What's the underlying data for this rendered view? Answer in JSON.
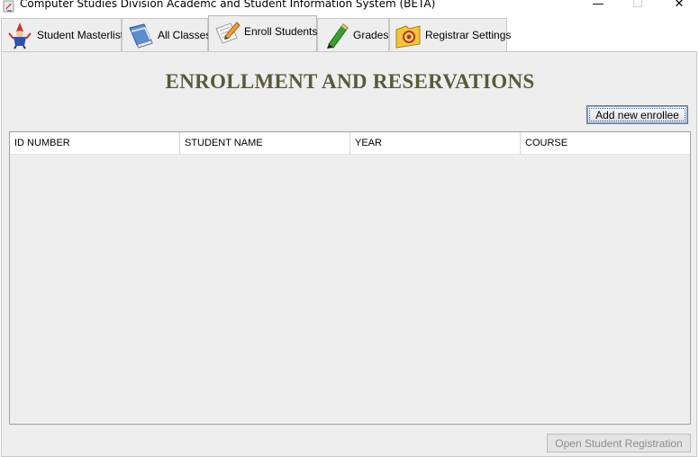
{
  "window": {
    "title": "Computer Studies Division Academc and Student Information System (BETA)",
    "minimize_glyph": "—",
    "maximize_glyph": "☐",
    "close_glyph": "✕"
  },
  "tabs": [
    {
      "label": "Student Masterlist",
      "icon": "wizard-icon",
      "active": false
    },
    {
      "label": "All Classes",
      "icon": "books-icon",
      "active": false
    },
    {
      "label": "Enroll Students",
      "icon": "pencil-paper-icon",
      "active": true
    },
    {
      "label": "Grades",
      "icon": "green-pencil-icon",
      "active": false
    },
    {
      "label": "Registrar Settings",
      "icon": "folder-settings-icon",
      "active": false
    }
  ],
  "panel": {
    "heading": "ENROLLMENT AND RESERVATIONS",
    "add_button": "Add new enrollee",
    "table": {
      "columns": [
        "ID NUMBER",
        "STUDENT NAME",
        "YEAR",
        "COURSE"
      ],
      "rows": []
    },
    "open_button": "Open Student Registration"
  },
  "colors": {
    "heading": "#5a5a3c",
    "panel_bg": "#eeeeee",
    "disabled_text": "#8e8e8e"
  }
}
